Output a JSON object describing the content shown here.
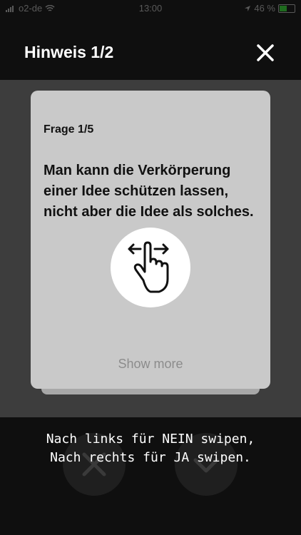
{
  "status_bar": {
    "carrier": "o2-de",
    "time": "13:00",
    "battery": "46 %",
    "icons": [
      "signal-icon",
      "wifi-icon",
      "location-icon",
      "battery-icon"
    ]
  },
  "header": {
    "title": "Hinweis 1/2",
    "close_icon": "close-icon"
  },
  "card": {
    "question_number": "Frage 1/5",
    "question_text": "Man kann die Verkörperung einer Idee schützen lassen, nicht aber die Idee als solches.",
    "show_more": "Show more",
    "gesture_icon": "swipe-hand-icon"
  },
  "actions": {
    "no_icon": "x-icon",
    "yes_icon": "chevron-down-icon"
  },
  "hint": {
    "line1": "Nach links für NEIN swipen,",
    "line2": "Nach rechts für JA swipen."
  },
  "colors": {
    "overlay": "#0f0f0f",
    "dim_background": "#3d3d3d",
    "card": "#c9c9c9",
    "text": "#ffffff"
  }
}
